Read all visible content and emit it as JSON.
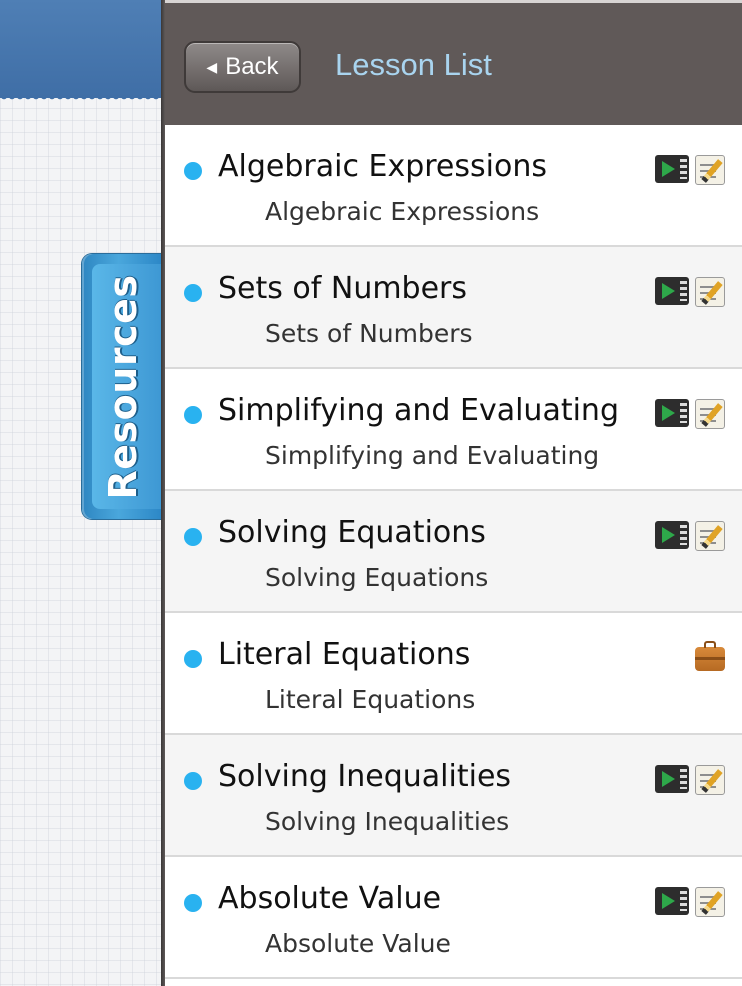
{
  "sidebar": {
    "resources_label": "Resources"
  },
  "header": {
    "back_label": "Back",
    "title": "Lesson List"
  },
  "colors": {
    "header_bg": "#605958",
    "title_color": "#a9d4ef",
    "bullet_color": "#29b2f0",
    "resources_tab": "#3d97d3"
  },
  "lessons": [
    {
      "title": "Algebraic Expressions",
      "subtitle": "Algebraic Expressions",
      "icons": [
        "video-icon",
        "note-icon"
      ]
    },
    {
      "title": "Sets of Numbers",
      "subtitle": "Sets of Numbers",
      "icons": [
        "video-icon",
        "note-icon"
      ]
    },
    {
      "title": "Simplifying and Evaluating",
      "subtitle": "Simplifying and Evaluating",
      "icons": [
        "video-icon",
        "note-icon"
      ]
    },
    {
      "title": "Solving Equations",
      "subtitle": "Solving Equations",
      "icons": [
        "video-icon",
        "note-icon"
      ]
    },
    {
      "title": "Literal Equations",
      "subtitle": "Literal Equations",
      "icons": [
        "briefcase-icon"
      ]
    },
    {
      "title": "Solving Inequalities",
      "subtitle": "Solving Inequalities",
      "icons": [
        "video-icon",
        "note-icon"
      ]
    },
    {
      "title": "Absolute Value",
      "subtitle": "Absolute Value",
      "icons": [
        "video-icon",
        "note-icon"
      ]
    }
  ]
}
